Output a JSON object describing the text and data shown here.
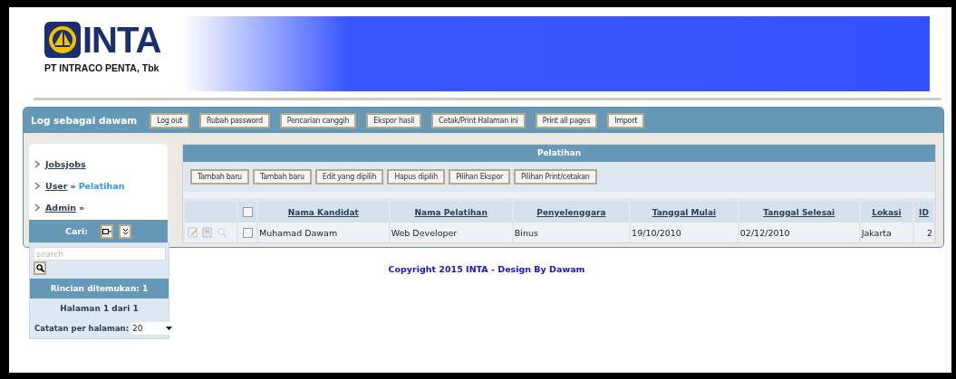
{
  "logo": {
    "mark": "INTA",
    "company": "PT INTRACO PENTA, Tbk"
  },
  "toolbar": {
    "user_label": "Log sebagai dawam",
    "buttons": [
      "Log out",
      "Rubah password",
      "Pencarian canggih",
      "Ekspor hasil",
      "Cetak/Print Halaman ini",
      "Print all pages",
      "Import"
    ]
  },
  "sidebar": {
    "items": [
      {
        "label": "Jobsjobs"
      },
      {
        "label": "User",
        "separator": "»",
        "current": "Pelatihan"
      },
      {
        "label": "Admin",
        "separator": "»"
      }
    ]
  },
  "cart": {
    "title": "Cari:",
    "search_placeholder": "search",
    "results": "Rincian ditemukan: 1",
    "pages": "Halaman 1 dari 1",
    "per_page_label": "Catatan per halaman:",
    "per_page_value": "20"
  },
  "table": {
    "title": "Pelatihan",
    "actions": [
      "Tambah baru",
      "Tambah baru",
      "Edit yang dipilih",
      "Hapus dipilih",
      "Pilihan Ekspor",
      "Pilihan Print/cetakan"
    ],
    "header_checked": false,
    "columns": [
      "Nama Kandidat",
      "Nama Pelatihan",
      "Penyelenggara",
      "Tanggal Mulai",
      "Tanggal Selesai",
      "Lokasi",
      "ID"
    ],
    "rows": [
      {
        "checked": false,
        "cells": [
          "Muhamad Dawam",
          "Web Developer",
          "Binus",
          "19/10/2010",
          "02/12/2010",
          "Jakarta",
          "2"
        ]
      }
    ]
  },
  "footer": "Copyright 2015 INTA - Design By Dawam"
}
